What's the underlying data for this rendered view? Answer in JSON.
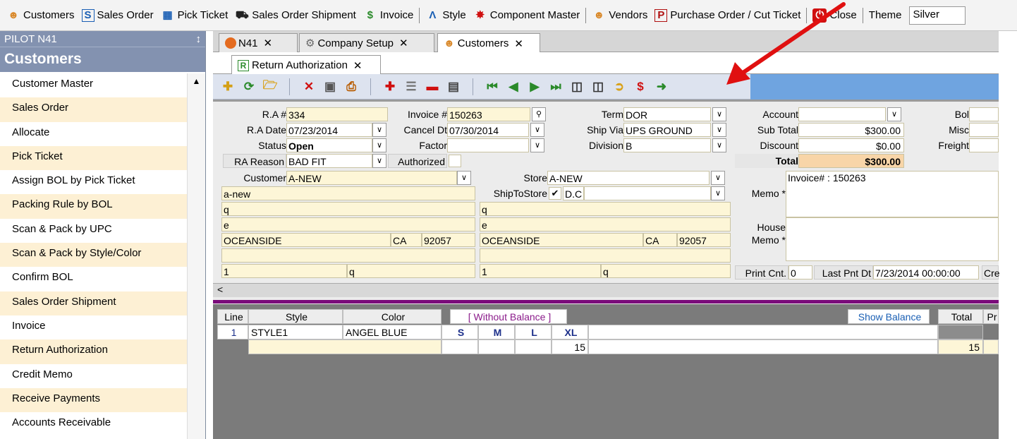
{
  "menu": {
    "items": [
      {
        "label": "Customers",
        "icon": "customers-icon"
      },
      {
        "label": "Sales Order",
        "icon": "sales-order-icon"
      },
      {
        "label": "Pick Ticket",
        "icon": "pick-ticket-icon"
      },
      {
        "label": "Sales Order Shipment",
        "icon": "shipment-icon"
      },
      {
        "label": "Invoice",
        "icon": "invoice-icon"
      },
      {
        "label": "Style",
        "icon": "style-icon"
      },
      {
        "label": "Component Master",
        "icon": "component-icon"
      },
      {
        "label": "Vendors",
        "icon": "vendors-icon"
      },
      {
        "label": "Purchase Order / Cut Ticket",
        "icon": "purchase-order-icon"
      },
      {
        "label": "Close",
        "icon": "close-power-icon"
      }
    ],
    "theme_label": "Theme",
    "theme_value": "Silver"
  },
  "sidebar": {
    "header": "PILOT  N41",
    "pin": "↕",
    "title": "Customers",
    "items": [
      {
        "label": "Customer Master"
      },
      {
        "label": "Sales Order"
      },
      {
        "label": "Allocate"
      },
      {
        "label": "Pick Ticket"
      },
      {
        "label": "Assign BOL by Pick Ticket"
      },
      {
        "label": "Packing Rule by BOL"
      },
      {
        "label": "Scan & Pack by UPC"
      },
      {
        "label": "Scan & Pack by Style/Color"
      },
      {
        "label": "Confirm BOL"
      },
      {
        "label": "Sales Order Shipment"
      },
      {
        "label": "Invoice"
      },
      {
        "label": "Return Authorization"
      },
      {
        "label": "Credit Memo"
      },
      {
        "label": "Receive Payments"
      },
      {
        "label": "Accounts Receivable"
      }
    ]
  },
  "tabs": [
    {
      "label": "N41"
    },
    {
      "label": "Company Setup"
    },
    {
      "label": "Customers"
    }
  ],
  "subtab": {
    "label": "Return Authorization"
  },
  "form": {
    "ra_no_label": "R.A #",
    "ra_no": "334",
    "ra_date_label": "R.A Date",
    "ra_date": "07/23/2014",
    "status_label": "Status",
    "status": "Open",
    "ra_reason_label": "RA Reason",
    "ra_reason": "BAD FIT",
    "invoice_label": "Invoice #",
    "invoice": "150263",
    "cancel_label": "Cancel Dt",
    "cancel": "07/30/2014",
    "factor_label": "Factor",
    "factor": "",
    "authorized_label": "Authorized",
    "term_label": "Term",
    "term": "DOR",
    "shipvia_label": "Ship Via",
    "shipvia": "UPS GROUND",
    "division_label": "Division",
    "division": "B",
    "account_label": "Account",
    "subtotal_label": "Sub Total",
    "subtotal": "$300.00",
    "discount_label": "Discount",
    "discount": "$0.00",
    "total_label": "Total",
    "total": "$300.00",
    "bol_label": "Bol",
    "misc_label": "Misc",
    "freight_label": "Freight",
    "customer_label": "Customer",
    "customer": "A-NEW",
    "bill_name": "a-new",
    "bill_addr1": "q",
    "bill_addr2": "e",
    "bill_city": "OCEANSIDE",
    "bill_state": "CA",
    "bill_zip": "92057",
    "bill_phone": "1",
    "bill_fax": "q",
    "store_label": "Store",
    "store": "A-NEW",
    "shiptostore_label": "ShipToStore",
    "shiptostore_check": "✔",
    "shiptostore_value": "D.C",
    "ship_addr1": "q",
    "ship_addr2": "e",
    "ship_city": "OCEANSIDE",
    "ship_state": "CA",
    "ship_zip": "92057",
    "ship_phone": "1",
    "ship_fax": "q",
    "memo_label": "Memo *",
    "memo": "Invoice# : 150263",
    "house_memo_label_1": "House",
    "house_memo_label_2": "Memo *",
    "print_cnt_label": "Print Cnt.",
    "print_cnt": "0",
    "last_pnt_label": "Last Pnt Dt",
    "last_pnt": "7/23/2014 00:00:00",
    "cre_label": "Cre"
  },
  "grid": {
    "scroll_left": "<",
    "headers": [
      "Line",
      "Style",
      "Color"
    ],
    "without_balance": "[ Without Balance ]",
    "show_balance": "Show Balance",
    "total_label": "Total",
    "pr_label": "Pr",
    "sizes": [
      "S",
      "M",
      "L",
      "XL"
    ],
    "rows": [
      {
        "line": "1",
        "style": "STYLE1",
        "color": "ANGEL BLUE",
        "xl_qty": "15",
        "total": "15"
      }
    ]
  },
  "colors": {
    "accent_arrow": "#e01010",
    "sidebar": "#8392b0",
    "field_yellow": "#fdf6d7",
    "grid_stripe": "#7a0b7a"
  }
}
